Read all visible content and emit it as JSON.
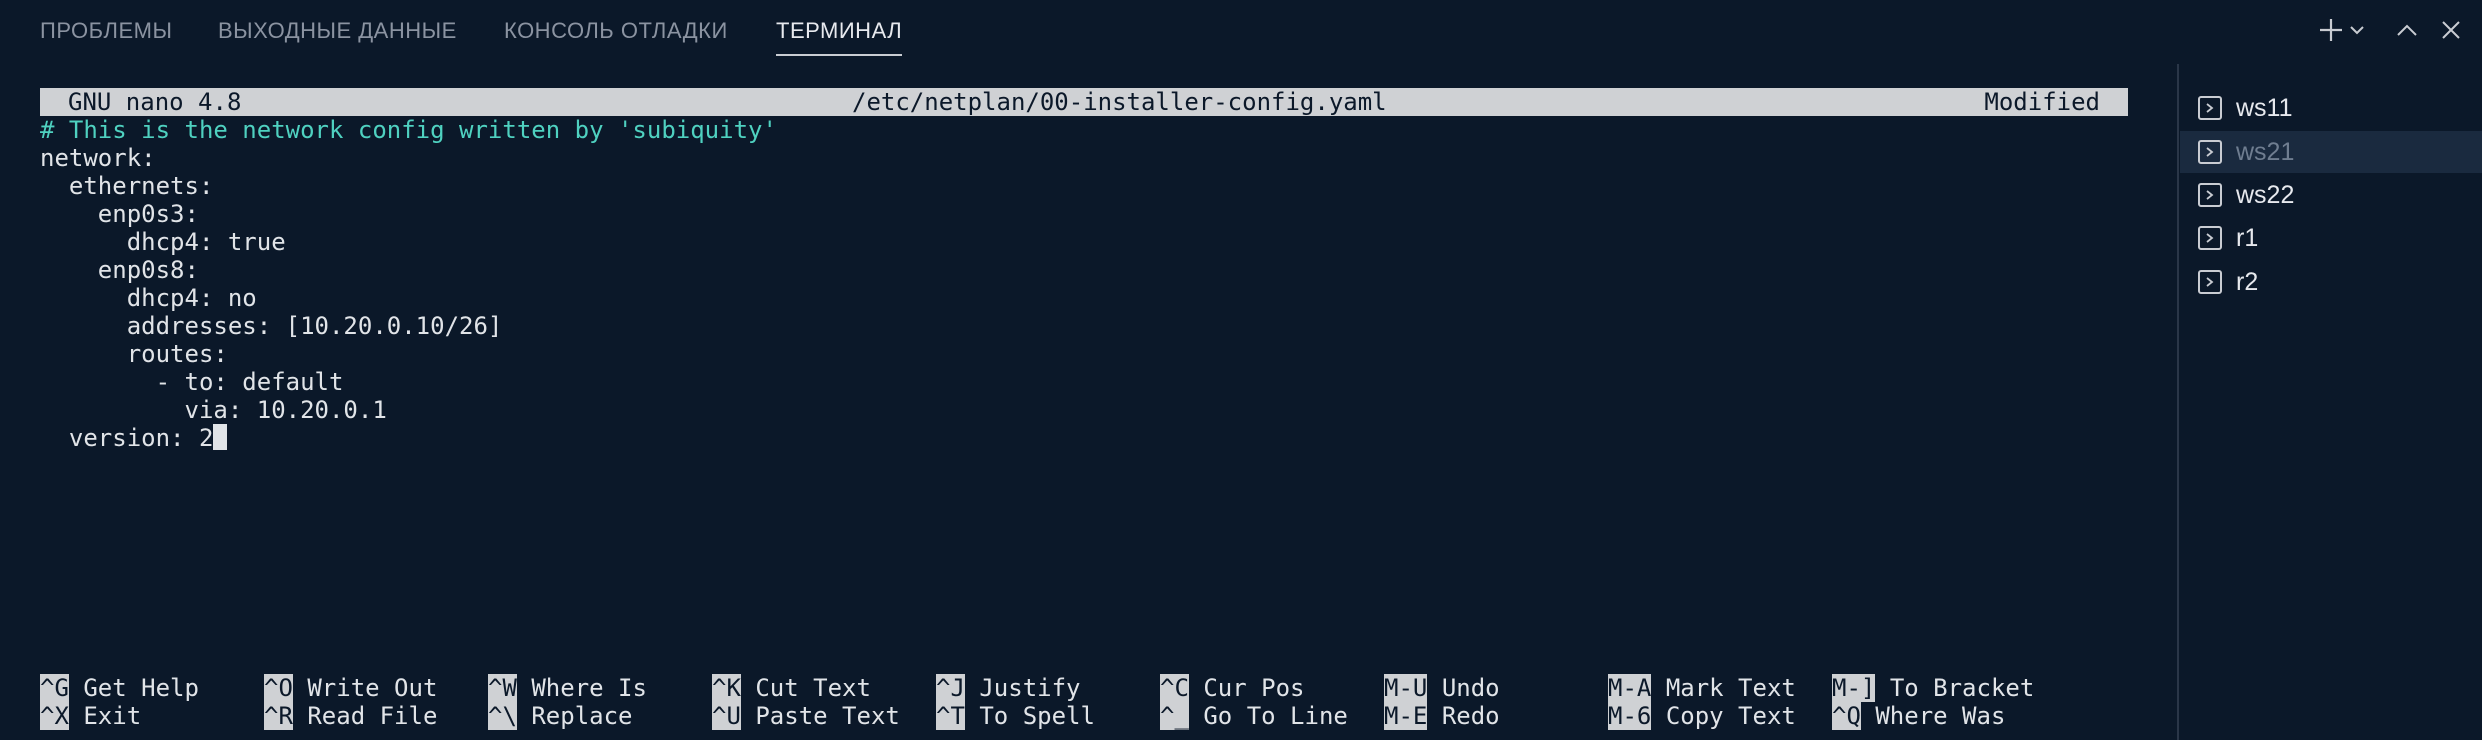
{
  "tabs": [
    {
      "label": "ПРОБЛЕМЫ",
      "active": false
    },
    {
      "label": "ВЫХОДНЫЕ ДАННЫЕ",
      "active": false
    },
    {
      "label": "КОНСОЛЬ ОТЛАДКИ",
      "active": false
    },
    {
      "label": "ТЕРМИНАЛ",
      "active": true
    }
  ],
  "actions": {
    "new_terminal_icon": "plus-icon",
    "dropdown_icon": "chevron-down-icon",
    "maximize_icon": "chevron-up-icon",
    "close_icon": "close-icon"
  },
  "nano": {
    "version": "GNU nano 4.8",
    "filename": "/etc/netplan/00-installer-config.yaml",
    "status": "Modified",
    "lines": [
      "# This is the network config written by 'subiquity'",
      "network:",
      "  ethernets:",
      "    enp0s3:",
      "      dhcp4: true",
      "    enp0s8:",
      "      dhcp4: no",
      "      addresses: [10.20.0.10/26]",
      "      routes:",
      "        - to: default",
      "          via: 10.20.0.1",
      "  version: 2"
    ],
    "shortcuts_row1": [
      {
        "key": "^G",
        "label": "Get Help"
      },
      {
        "key": "^O",
        "label": "Write Out"
      },
      {
        "key": "^W",
        "label": "Where Is"
      },
      {
        "key": "^K",
        "label": "Cut Text"
      },
      {
        "key": "^J",
        "label": "Justify"
      },
      {
        "key": "^C",
        "label": "Cur Pos"
      },
      {
        "key": "M-U",
        "label": "Undo"
      },
      {
        "key": "M-A",
        "label": "Mark Text"
      },
      {
        "key": "M-]",
        "label": "To Bracket"
      }
    ],
    "shortcuts_row2": [
      {
        "key": "^X",
        "label": "Exit"
      },
      {
        "key": "^R",
        "label": "Read File"
      },
      {
        "key": "^\\",
        "label": "Replace"
      },
      {
        "key": "^U",
        "label": "Paste Text"
      },
      {
        "key": "^T",
        "label": "To Spell"
      },
      {
        "key": "^_",
        "label": "Go To Line"
      },
      {
        "key": "M-E",
        "label": "Redo"
      },
      {
        "key": "M-6",
        "label": "Copy Text"
      },
      {
        "key": "^Q",
        "label": "Where Was"
      }
    ]
  },
  "terminals": [
    {
      "name": "ws11",
      "selected": false
    },
    {
      "name": "ws21",
      "selected": true
    },
    {
      "name": "ws22",
      "selected": false
    },
    {
      "name": "r1",
      "selected": false
    },
    {
      "name": "r2",
      "selected": false
    }
  ],
  "colors": {
    "background": "#0b1829",
    "comment": "#4fd1c0",
    "bar": "#cfd1d4"
  }
}
